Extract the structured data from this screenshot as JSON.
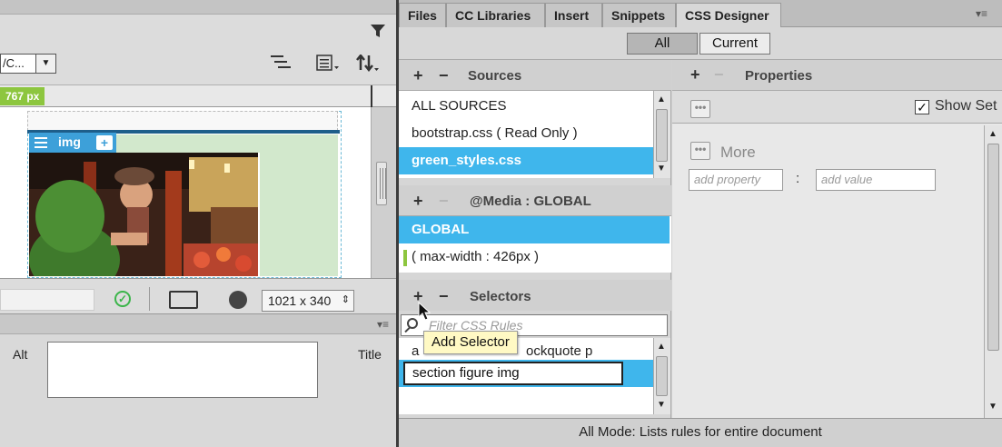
{
  "left_panel": {
    "doc_select_value": "/C...",
    "ruler_badge": "767 px",
    "image_tag": {
      "label": "img",
      "add": "+"
    },
    "status": {
      "size_value": "1021 x 340"
    },
    "properties": {
      "alt_label": "Alt",
      "title_label": "Title"
    }
  },
  "tabs": [
    "Files",
    "CC Libraries",
    "Insert",
    "Snippets",
    "CSS Designer"
  ],
  "mode_buttons": {
    "all": "All",
    "current": "Current"
  },
  "sources": {
    "title": "Sources",
    "items": [
      "ALL SOURCES",
      "bootstrap.css  ( Read Only )",
      "green_styles.css"
    ],
    "selected_index": 2
  },
  "media": {
    "title": "@Media : GLOBAL",
    "items": [
      "GLOBAL",
      "( max-width : 426px )"
    ],
    "selected_index": 0
  },
  "selectors": {
    "title": "Selectors",
    "filter_placeholder": "Filter CSS Rules",
    "tooltip": "Add Selector",
    "items": [
      "a",
      "ockquote p",
      "section figure img"
    ],
    "selected_index": 2
  },
  "properties": {
    "title": "Properties",
    "show_set_label": "Show Set",
    "show_set_checked": "✓",
    "more_label": "More",
    "add_property_placeholder": "add property",
    "add_value_placeholder": "add value"
  },
  "footer_text": "All Mode: Lists rules for entire document",
  "colors": {
    "selection": "#3fb6ec",
    "ruler_badge": "#8dc63f",
    "ok": "#3bb54a"
  }
}
